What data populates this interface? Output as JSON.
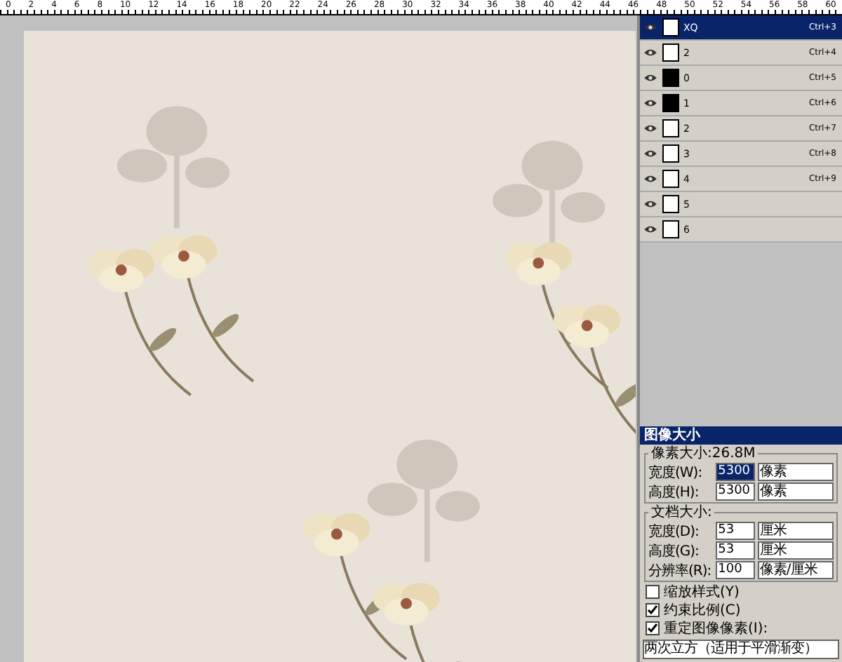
{
  "ruler": {
    "labels": [
      "0",
      "2",
      "4",
      "6",
      "8",
      "10",
      "12",
      "14",
      "16",
      "18",
      "20",
      "22",
      "24",
      "26",
      "28",
      "30",
      "32",
      "34",
      "36",
      "38",
      "40",
      "42",
      "44",
      "46",
      "48",
      "50",
      "52",
      "54",
      "56",
      "58",
      "60"
    ]
  },
  "channels": [
    {
      "name": "XQ",
      "shortcut": "Ctrl+3",
      "selected": true,
      "dark": false
    },
    {
      "name": "2",
      "shortcut": "Ctrl+4",
      "selected": false,
      "dark": false
    },
    {
      "name": "0",
      "shortcut": "Ctrl+5",
      "selected": false,
      "dark": true
    },
    {
      "name": "1",
      "shortcut": "Ctrl+6",
      "selected": false,
      "dark": true
    },
    {
      "name": "2",
      "shortcut": "Ctrl+7",
      "selected": false,
      "dark": false
    },
    {
      "name": "3",
      "shortcut": "Ctrl+8",
      "selected": false,
      "dark": false
    },
    {
      "name": "4",
      "shortcut": "Ctrl+9",
      "selected": false,
      "dark": false
    },
    {
      "name": "5",
      "selected": false,
      "dark": false
    },
    {
      "name": "6",
      "selected": false,
      "dark": false
    }
  ],
  "dialog": {
    "title": "图像大小",
    "pixel_group": {
      "legend": "像素大小:26.8M",
      "fields": [
        {
          "label": "宽度(W):",
          "value": "5300",
          "unit": "像素"
        },
        {
          "label": "高度(H):",
          "value": "5300",
          "unit": "像素"
        }
      ]
    },
    "document_group": {
      "legend": "文档大小:",
      "fields": [
        {
          "label": "宽度(D):",
          "value": "53",
          "unit": "厘米"
        },
        {
          "label": "高度(G):",
          "value": "53",
          "unit": "厘米"
        },
        {
          "label": "分辨率(R):",
          "value": "100",
          "unit": "像素/厘米"
        }
      ]
    },
    "checkboxes": [
      {
        "label": "缩放样式(Y)",
        "checked": false
      },
      {
        "label": "约束比例(C)",
        "checked": true
      },
      {
        "label": "重定图像像素(I):",
        "checked": true
      }
    ],
    "resample": "两次立方（适用于平滑渐变）"
  }
}
